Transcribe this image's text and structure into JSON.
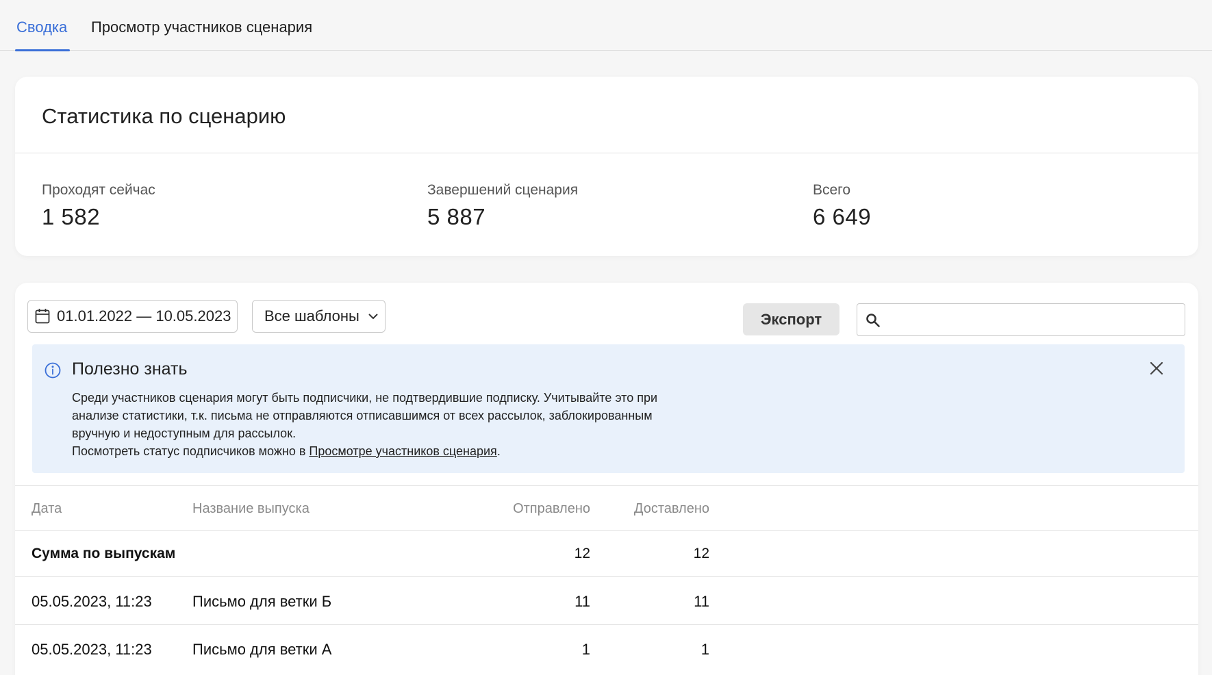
{
  "tabs": [
    {
      "label": "Сводка",
      "active": true
    },
    {
      "label": "Просмотр участников сценария",
      "active": false
    }
  ],
  "stats_card": {
    "title": "Статистика по сценарию",
    "items": [
      {
        "label": "Проходят сейчас",
        "value": "1 582"
      },
      {
        "label": "Завершений сценария",
        "value": "5 887"
      },
      {
        "label": "Всего",
        "value": "6 649"
      }
    ]
  },
  "filters": {
    "date_range": "01.01.2022 — 10.05.2023",
    "template_select": "Все шаблоны",
    "export_label": "Экспорт",
    "search_placeholder": ""
  },
  "info": {
    "title": "Полезно знать",
    "text": "Среди участников сценария могут быть подписчики, не подтвердившие подписку. Учитывайте это при анализе статистики, т.к. письма не отправляются отписавшимся от всех рассылок, заблокированным вручную и недоступным для рассылок.",
    "text2_prefix": "Посмотреть статус подписчиков можно в ",
    "text2_link": "Просмотре участников сценария",
    "text2_suffix": "."
  },
  "table": {
    "headers": {
      "date": "Дата",
      "name": "Название выпуска",
      "sent": "Отправлено",
      "delivered": "Доставлено"
    },
    "sum_row": {
      "label": "Сумма по выпускам",
      "sent": "12",
      "delivered": "12"
    },
    "rows": [
      {
        "date": "05.05.2023, 11:23",
        "name": "Письмо для ветки Б",
        "sent": "11",
        "delivered": "11"
      },
      {
        "date": "05.05.2023, 11:23",
        "name": "Письмо для ветки А",
        "sent": "1",
        "delivered": "1"
      }
    ]
  },
  "colors": {
    "accent": "#3a6fd8",
    "info_bg": "#e9f1fb"
  }
}
